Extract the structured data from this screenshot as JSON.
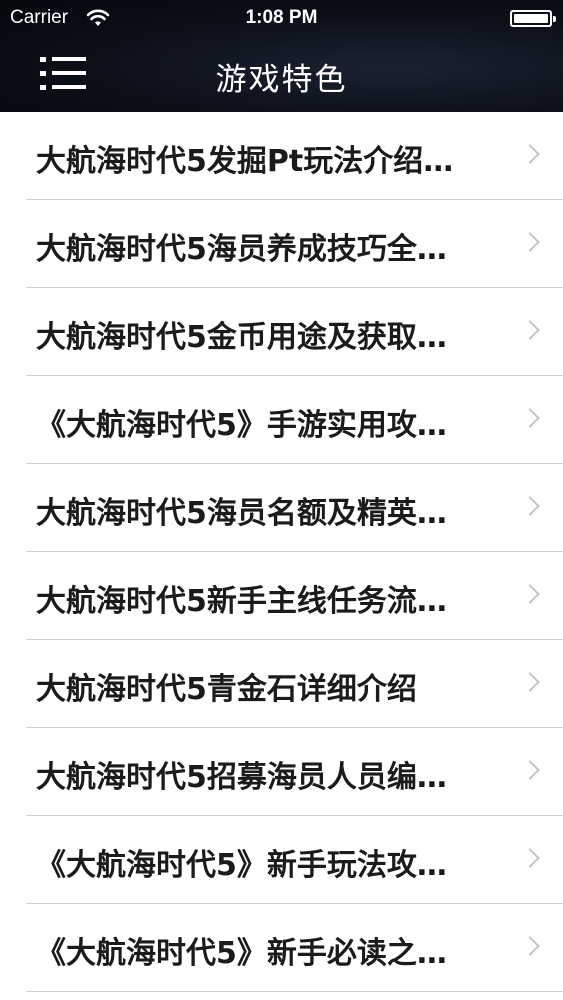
{
  "status_bar": {
    "carrier": "Carrier",
    "time": "1:08 PM"
  },
  "nav": {
    "title": "游戏特色",
    "menu_icon": "menu-icon"
  },
  "colors": {
    "nav_background": "#0b0f18",
    "text": "#1b1b1b",
    "chevron": "#c4c4c9",
    "separator": "#d0d0d4"
  },
  "items": [
    {
      "label": "大航海时代5发掘Pt玩法介绍…"
    },
    {
      "label": "大航海时代5海员养成技巧全…"
    },
    {
      "label": "大航海时代5金币用途及获取…"
    },
    {
      "label": "《大航海时代5》手游实用攻…"
    },
    {
      "label": "大航海时代5海员名额及精英…"
    },
    {
      "label": "大航海时代5新手主线任务流…"
    },
    {
      "label": "大航海时代5青金石详细介绍"
    },
    {
      "label": "大航海时代5招募海员人员编…"
    },
    {
      "label": "《大航海时代5》新手玩法攻…"
    },
    {
      "label": "《大航海时代5》新手必读之…"
    }
  ]
}
